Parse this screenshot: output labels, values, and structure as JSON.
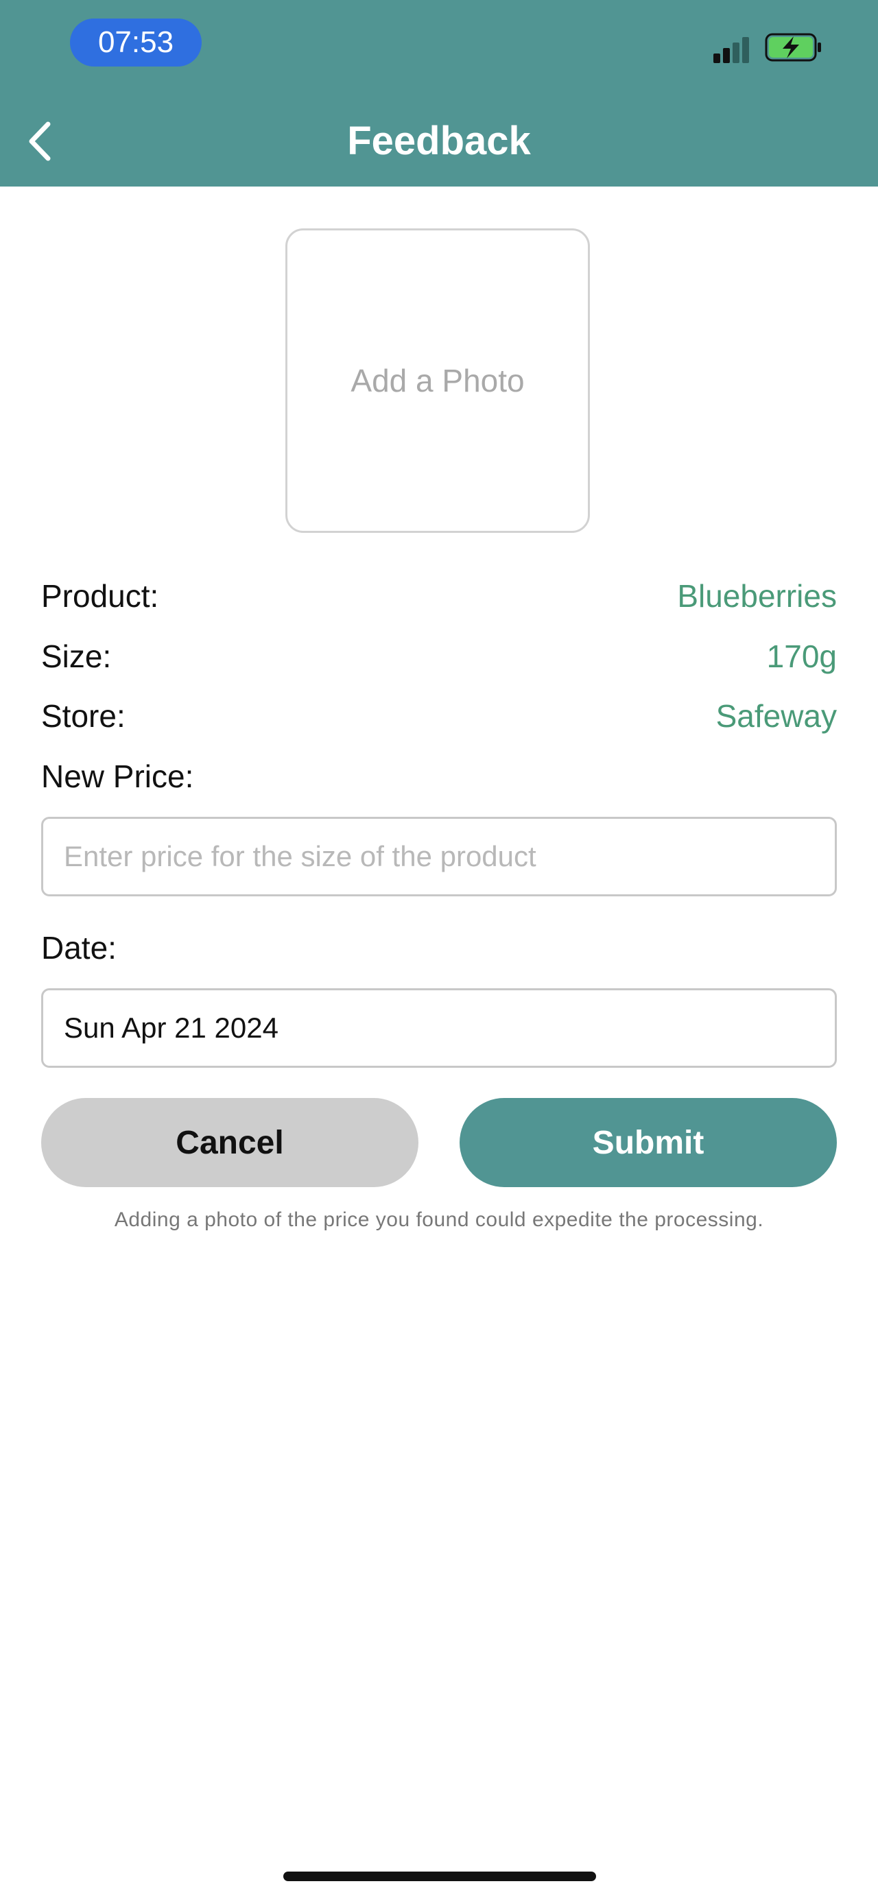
{
  "status_bar": {
    "time": "07:53",
    "signal_bars_active": 2,
    "signal_bars_total": 4,
    "battery_state": "charging",
    "colors": {
      "time_pill": "#2f6fe0",
      "battery_fill": "#5fd05f"
    }
  },
  "header": {
    "title": "Feedback",
    "back_icon": "chevron-left-icon",
    "background": "#519593"
  },
  "photo": {
    "label": "Add a Photo"
  },
  "details": [
    {
      "label": "Product:",
      "value": "Blueberries"
    },
    {
      "label": "Size:",
      "value": "170g"
    },
    {
      "label": "Store:",
      "value": "Safeway"
    }
  ],
  "new_price": {
    "label": "New Price:",
    "placeholder": "Enter price for the size of the product",
    "value": ""
  },
  "date": {
    "label": "Date:",
    "value": "Sun Apr 21 2024"
  },
  "buttons": {
    "cancel": "Cancel",
    "submit": "Submit"
  },
  "hint": "Adding a photo of the price you found could expedite the processing.",
  "colors": {
    "accent": "#519593",
    "detail_value": "#4a9a78",
    "cancel_bg": "#cdcdcd"
  }
}
